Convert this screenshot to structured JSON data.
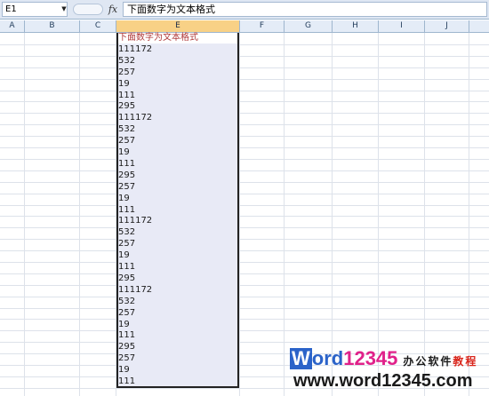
{
  "formula_bar": {
    "name_box": "E1",
    "formula_text": "下面数字为文本格式"
  },
  "columns": [
    "A",
    "B",
    "C",
    "E",
    "F",
    "G",
    "H",
    "I",
    "J"
  ],
  "cells_E": [
    "下面数字为文本格式",
    "111172",
    "532",
    "257",
    "19",
    "111",
    "295",
    "111172",
    "532",
    "257",
    "19",
    "111",
    "295",
    "257",
    "19",
    "111",
    "111172",
    "532",
    "257",
    "19",
    "111",
    "295",
    "111172",
    "532",
    "257",
    "19",
    "111",
    "295",
    "257",
    "19",
    "111"
  ],
  "watermark": {
    "brand_W": "W",
    "brand_rest": "ord",
    "brand_digits": "12345",
    "tagline_a": "办公软件",
    "tagline_b": "教程",
    "url": "www.word12345.com"
  }
}
